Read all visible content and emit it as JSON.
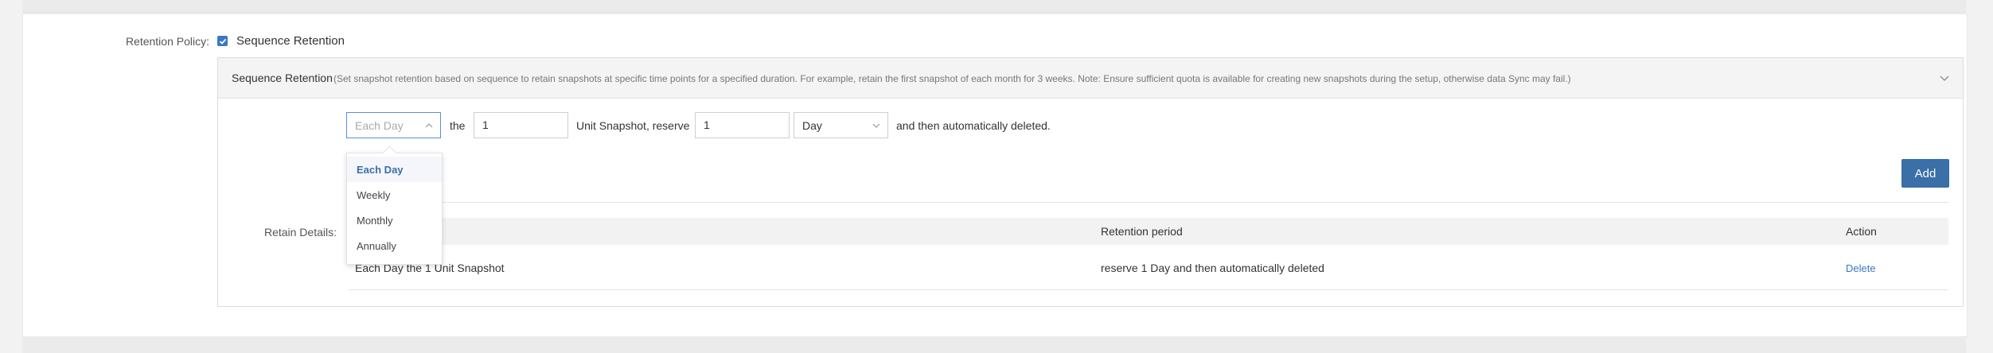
{
  "retention_policy": {
    "label": "Retention Policy:",
    "checkbox_label": "Sequence Retention",
    "checked": true
  },
  "panel": {
    "title": "Sequence Retention",
    "description": "(Set snapshot retention based on sequence to retain snapshots at specific time points for a specified duration. For example, retain the first snapshot of each month for 3 weeks. Note: Ensure sufficient quota is available for creating new snapshots during the setup, otherwise data Sync may fail.)"
  },
  "rule": {
    "frequency_placeholder": "Each Day",
    "the_text": "the",
    "unit_value": "1",
    "unit_text": "Unit Snapshot, reserve",
    "reserve_value": "1",
    "period_unit": "Day",
    "suffix_text": "and then automatically deleted."
  },
  "frequency_options": [
    "Each Day",
    "Weekly",
    "Monthly",
    "Annually"
  ],
  "frequency_selected": "Each Day",
  "add_button": "Add",
  "retain_details": {
    "label": "Retain Details:",
    "columns": [
      "Retention period",
      "Action"
    ],
    "rows": [
      {
        "rule": "Each Day the 1 Unit Snapshot",
        "period": "reserve 1 Day and then automatically deleted",
        "action": "Delete"
      }
    ]
  },
  "colors": {
    "accent": "#3a6fa7",
    "link": "#3a78c4"
  },
  "icons": {
    "checkbox": "check-icon",
    "collapse": "chevron-down-icon",
    "select_open": "chevron-up-icon",
    "select_closed": "chevron-down-icon"
  }
}
